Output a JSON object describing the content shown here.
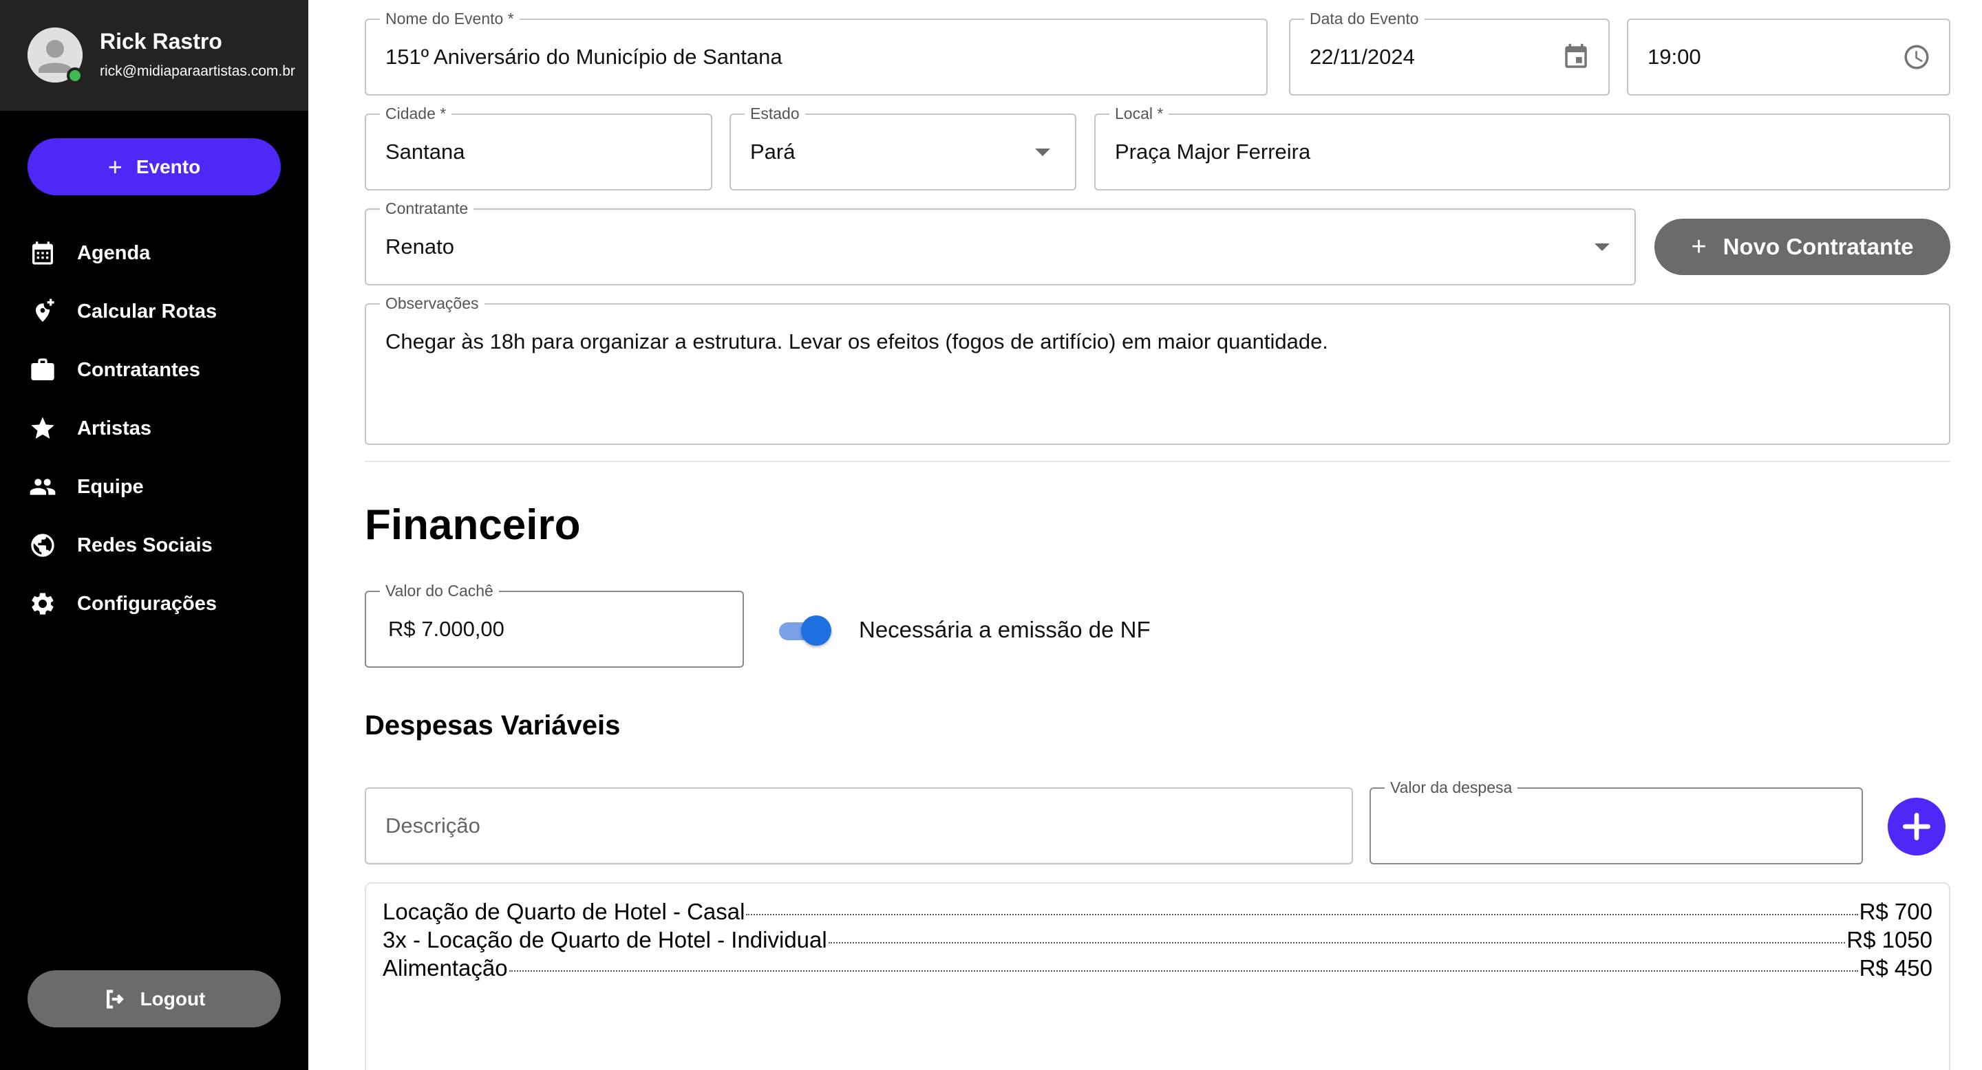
{
  "user": {
    "name": "Rick Rastro",
    "email": "rick@midiaparaartistas.com.br",
    "status_color": "#3fb950"
  },
  "sidebar": {
    "new_event_label": "Evento",
    "items": [
      {
        "label": "Agenda",
        "icon": "calendar-icon"
      },
      {
        "label": "Calcular Rotas",
        "icon": "add-location-icon"
      },
      {
        "label": "Contratantes",
        "icon": "briefcase-icon"
      },
      {
        "label": "Artistas",
        "icon": "star-icon"
      },
      {
        "label": "Equipe",
        "icon": "group-icon"
      },
      {
        "label": "Redes Sociais",
        "icon": "globe-icon"
      },
      {
        "label": "Configurações",
        "icon": "gear-icon"
      }
    ],
    "logout_label": "Logout"
  },
  "form": {
    "event_name": {
      "label": "Nome do Evento",
      "required_mark": "*",
      "value": "151º Aniversário do Município de Santana"
    },
    "event_date": {
      "label": "Data do Evento",
      "value": "22/11/2024"
    },
    "event_time": {
      "value": "19:00"
    },
    "city": {
      "label": "Cidade",
      "required_mark": "*",
      "value": "Santana"
    },
    "state": {
      "label": "Estado",
      "value": "Pará"
    },
    "venue": {
      "label": "Local",
      "required_mark": "*",
      "value": "Praça Major Ferreira"
    },
    "contractor": {
      "label": "Contratante",
      "value": "Renato"
    },
    "new_contractor_label": "Novo Contratante",
    "notes": {
      "label": "Observações",
      "value": "Chegar às 18h para organizar a estrutura. Levar os efeitos (fogos de artifício) em maior quantidade."
    }
  },
  "financeiro": {
    "title": "Financeiro",
    "fee": {
      "label": "Valor do Cachê",
      "value": "R$ 7.000,00"
    },
    "nf_toggle": {
      "label": "Necessária a emissão de NF",
      "checked": true
    },
    "expenses": {
      "title": "Despesas Variáveis",
      "description_placeholder": "Descrição",
      "value_label": "Valor da despesa",
      "value_input": "",
      "items": [
        {
          "description": "Locação de Quarto de Hotel - Casal",
          "amount": "R$ 700"
        },
        {
          "description": "3x - Locação de Quarto de Hotel - Individual",
          "amount": "R$ 1050"
        },
        {
          "description": "Alimentação",
          "amount": "R$ 450"
        }
      ]
    }
  },
  "colors": {
    "accent": "#4f27f7",
    "sidebar_bg": "#000000",
    "user_box_bg": "#232323",
    "secondary_button": "#6b6b6b",
    "toggle_on": "#1e6fe0"
  }
}
